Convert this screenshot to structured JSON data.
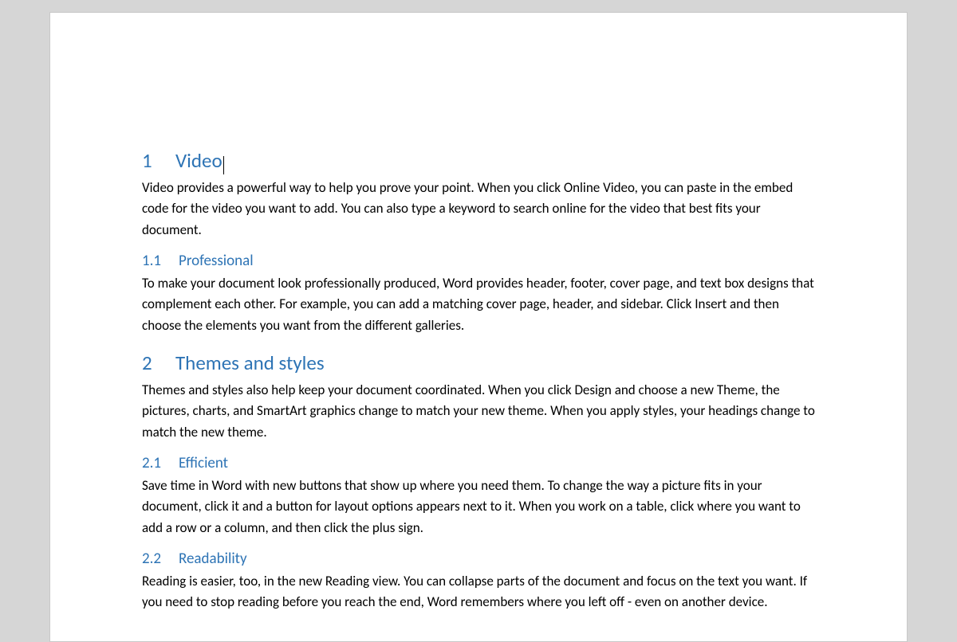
{
  "doc": {
    "h1_1_num": "1",
    "h1_1_title": "Video",
    "p1": "Video provides a powerful way to help you prove your point. When you click Online Video, you can paste in the embed code for the video you want to add. You can also type a keyword to search online for the video that best fits your document.",
    "h2_11_num": "1.1",
    "h2_11_title": "Professional",
    "p11": "To make your document look professionally produced, Word provides header, footer, cover page, and text box designs that complement each other. For example, you can add a matching cover page, header, and sidebar. Click Insert and then choose the elements you want from the different galleries.",
    "h1_2_num": "2",
    "h1_2_title": "Themes and styles",
    "p2": "Themes and styles also help keep your document coordinated. When you click Design and choose a new Theme, the pictures, charts, and SmartArt graphics change to match your new theme. When you apply styles, your headings change to match the new theme.",
    "h2_21_num": "2.1",
    "h2_21_title": "Efficient",
    "p21": "Save time in Word with new buttons that show up where you need them. To change the way a picture fits in your document, click it and a button for layout options appears next to it. When you work on a table, click where you want to add a row or a column, and then click the plus sign.",
    "h2_22_num": "2.2",
    "h2_22_title": "Readability",
    "p22": "Reading is easier, too, in the new Reading view. You can collapse parts of the document and focus on the text you want. If you need to stop reading before you reach the end, Word remembers where you left off - even on another device."
  }
}
